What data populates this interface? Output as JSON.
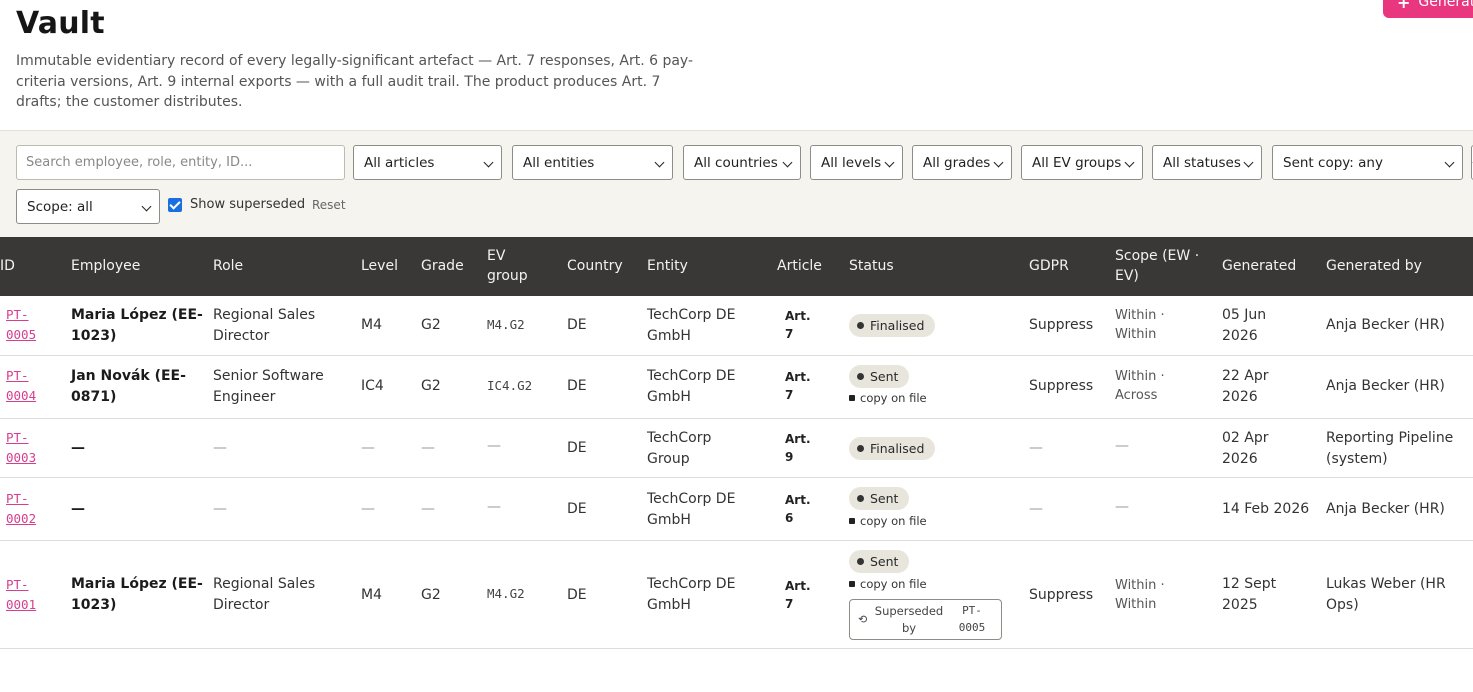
{
  "header": {
    "title": "Vault",
    "generate_label": "Generate",
    "description": "Immutable evidentiary record of every legally-significant artefact — Art. 7 responses, Art. 6 pay-criteria versions, Art. 9 internal exports — with a full audit trail. The product produces Art. 7 drafts; the customer distributes."
  },
  "filters": {
    "search_placeholder": "Search employee, role, entity, ID...",
    "articles": "All articles",
    "entities": "All entities",
    "countries": "All countries",
    "levels": "All levels",
    "grades": "All grades",
    "ev_groups": "All EV groups",
    "statuses": "All statuses",
    "sent_copy": "Sent copy: any",
    "scope": "Scope: all",
    "show_superseded_label": "Show superseded",
    "show_superseded": true,
    "reset_label": "Reset"
  },
  "table": {
    "columns": {
      "id": "ID",
      "employee": "Employee",
      "role": "Role",
      "level": "Level",
      "grade": "Grade",
      "ev_group_1": "EV",
      "ev_group_2": "group",
      "country": "Country",
      "entity": "Entity",
      "article": "Article",
      "status": "Status",
      "gdpr": "GDPR",
      "scope_1": "Scope (EW ·",
      "scope_2": "EV)",
      "generated": "Generated",
      "generated_by": "Generated by"
    },
    "rows": [
      {
        "id_1": "PT-",
        "id_2": "0005",
        "employee_1": "Maria López (EE-",
        "employee_2": "1023)",
        "role_1": "Regional Sales",
        "role_2": "Director",
        "level": "M4",
        "grade": "G2",
        "ev_group": "M4.G2",
        "country": "DE",
        "entity_1": "TechCorp DE",
        "entity_2": "GmbH",
        "article_1": "Art.",
        "article_2": "7",
        "status": "Finalised",
        "gdpr": "Suppress",
        "scope_1": "Within ·",
        "scope_2": "Within",
        "generated_1": "05 Jun",
        "generated_2": "2026",
        "generated_by": "Anja Becker (HR)"
      },
      {
        "id_1": "PT-",
        "id_2": "0004",
        "employee_1": "Jan Novák (EE-",
        "employee_2": "0871)",
        "role_1": "Senior Software",
        "role_2": "Engineer",
        "level": "IC4",
        "grade": "G2",
        "ev_group": "IC4.G2",
        "country": "DE",
        "entity_1": "TechCorp DE",
        "entity_2": "GmbH",
        "article_1": "Art.",
        "article_2": "7",
        "status": "Sent",
        "copy": "copy on file",
        "gdpr": "Suppress",
        "scope_1": "Within ·",
        "scope_2": "Across",
        "generated_1": "22 Apr",
        "generated_2": "2026",
        "generated_by": "Anja Becker (HR)"
      },
      {
        "id_1": "PT-",
        "id_2": "0003",
        "employee": "—",
        "role": "—",
        "level": "—",
        "grade": "—",
        "ev_group": "—",
        "country": "DE",
        "entity_1": "TechCorp",
        "entity_2": "Group",
        "article_1": "Art.",
        "article_2": "9",
        "status": "Finalised",
        "gdpr": "—",
        "scope": "—",
        "generated_1": "02 Apr",
        "generated_2": "2026",
        "generated_by_1": "Reporting Pipeline",
        "generated_by_2": "(system)"
      },
      {
        "id_1": "PT-",
        "id_2": "0002",
        "employee": "—",
        "role": "—",
        "level": "—",
        "grade": "—",
        "ev_group": "—",
        "country": "DE",
        "entity_1": "TechCorp DE",
        "entity_2": "GmbH",
        "article_1": "Art.",
        "article_2": "6",
        "status": "Sent",
        "copy": "copy on file",
        "gdpr": "—",
        "scope": "—",
        "generated": "14 Feb 2026",
        "generated_by": "Anja Becker (HR)"
      },
      {
        "id_1": "PT-",
        "id_2": "0001",
        "employee_1": "Maria López (EE-",
        "employee_2": "1023)",
        "role_1": "Regional Sales",
        "role_2": "Director",
        "level": "M4",
        "grade": "G2",
        "ev_group": "M4.G2",
        "country": "DE",
        "entity_1": "TechCorp DE",
        "entity_2": "GmbH",
        "article_1": "Art.",
        "article_2": "7",
        "status": "Sent",
        "copy": "copy on file",
        "superseded_label_1": "Superseded",
        "superseded_label_2": "by",
        "superseded_ref_1": "PT-",
        "superseded_ref_2": "0005",
        "gdpr": "Suppress",
        "scope_1": "Within ·",
        "scope_2": "Within",
        "generated_1": "12 Sept",
        "generated_2": "2025",
        "generated_by_1": "Lukas Weber (HR",
        "generated_by_2": "Ops)"
      }
    ]
  }
}
